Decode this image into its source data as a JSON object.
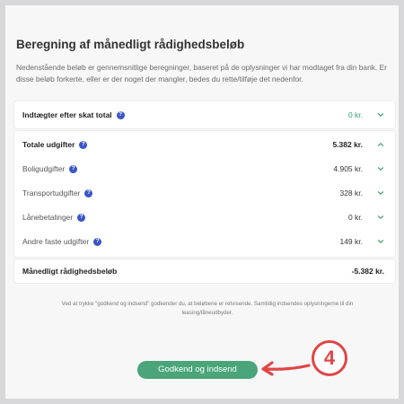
{
  "title": "Beregning af månedligt rådighedsbeløb",
  "description": "Nedenstående beløb er gennemsnitlige beregninger, baseret på de oplysninger vi har modtaget fra din bank. Er disse beløb forkerte, eller er der noget der mangler, bedes du rette/tilføje det nedenfor.",
  "income": {
    "label": "Indtægter efter skat total",
    "value": "0 kr."
  },
  "expenses": {
    "total": {
      "label": "Totale udgifter",
      "value": "5.382 kr."
    },
    "items": [
      {
        "label": "Boligudgifter",
        "value": "4.905 kr."
      },
      {
        "label": "Transportudgifter",
        "value": "328 kr."
      },
      {
        "label": "Lånebetalinger",
        "value": "0 kr."
      },
      {
        "label": "Andre faste udgifter",
        "value": "149 kr."
      }
    ]
  },
  "result": {
    "label": "Månedligt rådighedsbeløb",
    "value": "-5.382 kr."
  },
  "footnote": "Ved at trykke \"godkend og indsend\" godkender du, at beløbene er retvisende. Samtidig indsendes oplysningerne til din leasing/låneudbyder.",
  "submit_label": "Godkend og indsend",
  "step_badge": "4",
  "colors": {
    "accent_green": "#4aa57a",
    "info_blue": "#3b55c7",
    "annotation_red": "#e04545"
  }
}
